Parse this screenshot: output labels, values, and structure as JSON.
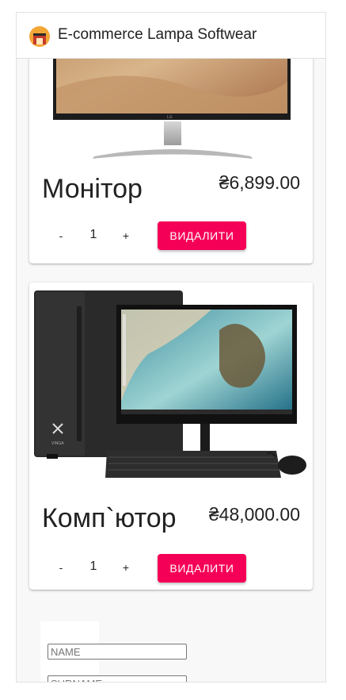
{
  "app": {
    "title": "E-commerce Lampa Softwear"
  },
  "cart": {
    "items": [
      {
        "name": "Монітор",
        "price": "₴6,899.00",
        "quantity": "1",
        "decrement": "-",
        "increment": "+",
        "remove_label": "ВИДАЛИТИ"
      },
      {
        "name": "Комп`ютор",
        "price": "₴48,000.00",
        "quantity": "1",
        "decrement": "-",
        "increment": "+",
        "remove_label": "ВИДАЛИТИ"
      }
    ]
  },
  "form": {
    "name_placeholder": "NAME",
    "surname_placeholder": "SURNAME"
  },
  "colors": {
    "accent": "#f50057",
    "background": "#f8f8f8"
  }
}
